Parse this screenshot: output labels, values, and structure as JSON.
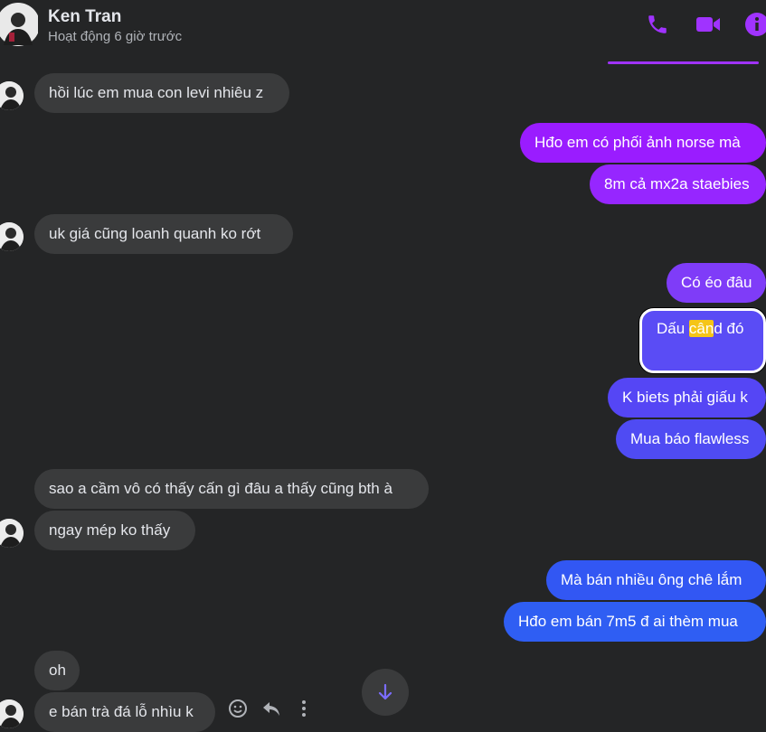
{
  "header": {
    "name": "Ken Tran",
    "status": "Hoạt động 6 giờ trước",
    "icons": [
      "phone-icon",
      "video-camera-icon",
      "info-icon"
    ],
    "accent_color": "#a033ff"
  },
  "messages": [
    {
      "side": "received",
      "text": "hồi lúc em mua con levi nhiêu z"
    },
    {
      "side": "sent",
      "text": "Hđo em có phối ảnh norse mà"
    },
    {
      "side": "sent",
      "text": "8m cả mx2a staebies"
    },
    {
      "side": "received",
      "text": "uk giá cũng loanh quanh ko rớt"
    },
    {
      "side": "sent",
      "text": "Có éo đâu"
    },
    {
      "side": "sent",
      "text_before": "Dấu ",
      "text_highlight": "cân",
      "text_after": "d đó",
      "highlighted": true
    },
    {
      "side": "sent",
      "text": "K biets phải giấu k"
    },
    {
      "side": "sent",
      "text": "Mua báo flawless"
    },
    {
      "side": "received",
      "text": "sao a cầm vô có thấy cấn gì đâu a thấy cũng bth à"
    },
    {
      "side": "received",
      "text": "ngay mép ko thấy"
    },
    {
      "side": "sent",
      "text": "Mà bán nhiều ông chê lắm"
    },
    {
      "side": "sent",
      "text": "Hđo em bán 7m5 đ ai thèm mua"
    },
    {
      "side": "received",
      "text": "oh"
    },
    {
      "side": "received",
      "text": "e bán trà đá lỗ nhìu k"
    }
  ],
  "colors": {
    "background": "#242526",
    "received_bubble": "#3a3b3c",
    "sent_purple": "#9a1cff",
    "sent_violet": "#6d44f5",
    "sent_blue": "#2f5ef3",
    "search_highlight": "#f5c518"
  },
  "message_actions": [
    "emoji-reaction-icon",
    "reply-icon",
    "more-options-icon"
  ],
  "scroll_button_icon": "arrow-down-icon"
}
